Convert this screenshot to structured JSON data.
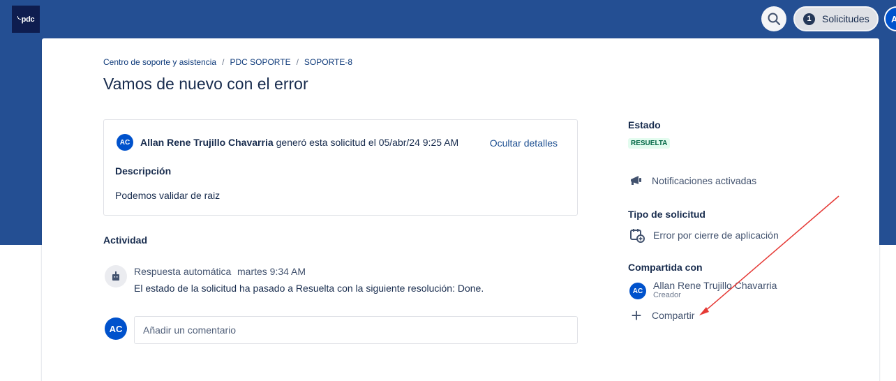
{
  "header": {
    "logo_text": "pdc",
    "requests_count": "1",
    "requests_label": "Solicitudes",
    "profile_initial": "A"
  },
  "breadcrumb": {
    "items": [
      "Centro de soporte y asistencia",
      "PDC SOPORTE",
      "SOPORTE-8"
    ],
    "separator": "/"
  },
  "page_title": "Vamos de nuevo con el error",
  "details": {
    "author_initials": "AC",
    "author": "Allan Rene Trujillo Chavarria",
    "meta": "generó esta solicitud el 05/abr/24 9:25 AM",
    "hide_label": "Ocultar detalles",
    "description_label": "Descripción",
    "description_text": "Podemos validar de raiz"
  },
  "activity": {
    "label": "Actividad",
    "items": [
      {
        "author": "Respuesta automática",
        "time": "martes 9:34 AM",
        "text": "El estado de la solicitud ha pasado a Resuelta con la siguiente resolución: Done."
      }
    ],
    "comment_avatar": "AC",
    "comment_placeholder": "Añadir un comentario"
  },
  "sidebar": {
    "status_label": "Estado",
    "status_value": "RESUELTA",
    "notifications_label": "Notificaciones activadas",
    "type_label": "Tipo de solicitud",
    "type_value": "Error por cierre de aplicación",
    "shared_label": "Compartida con",
    "shared_person": {
      "initials": "AC",
      "name": "Allan Rene Trujillo Chavarria",
      "role": "Creador"
    },
    "share_label": "Compartir"
  },
  "colors": {
    "brand_band": "#244f93",
    "link": "#1d4f91",
    "avatar": "#0052cc",
    "status_bg": "#e3fcef",
    "status_text": "#006644",
    "annotation_arrow": "#e53935"
  },
  "icons": {
    "search": "search-icon",
    "notifications": "megaphone-icon",
    "request_type": "calendar-plus-icon",
    "bot": "robot-icon",
    "share": "plus-icon"
  }
}
